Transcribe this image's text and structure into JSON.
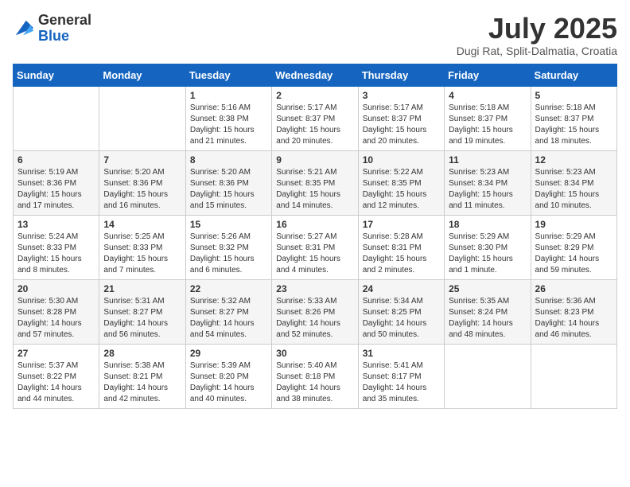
{
  "logo": {
    "general": "General",
    "blue": "Blue"
  },
  "title": {
    "month": "July 2025",
    "location": "Dugi Rat, Split-Dalmatia, Croatia"
  },
  "weekdays": [
    "Sunday",
    "Monday",
    "Tuesday",
    "Wednesday",
    "Thursday",
    "Friday",
    "Saturday"
  ],
  "weeks": [
    [
      {
        "day": "",
        "info": ""
      },
      {
        "day": "",
        "info": ""
      },
      {
        "day": "1",
        "info": "Sunrise: 5:16 AM\nSunset: 8:38 PM\nDaylight: 15 hours and 21 minutes."
      },
      {
        "day": "2",
        "info": "Sunrise: 5:17 AM\nSunset: 8:37 PM\nDaylight: 15 hours and 20 minutes."
      },
      {
        "day": "3",
        "info": "Sunrise: 5:17 AM\nSunset: 8:37 PM\nDaylight: 15 hours and 20 minutes."
      },
      {
        "day": "4",
        "info": "Sunrise: 5:18 AM\nSunset: 8:37 PM\nDaylight: 15 hours and 19 minutes."
      },
      {
        "day": "5",
        "info": "Sunrise: 5:18 AM\nSunset: 8:37 PM\nDaylight: 15 hours and 18 minutes."
      }
    ],
    [
      {
        "day": "6",
        "info": "Sunrise: 5:19 AM\nSunset: 8:36 PM\nDaylight: 15 hours and 17 minutes."
      },
      {
        "day": "7",
        "info": "Sunrise: 5:20 AM\nSunset: 8:36 PM\nDaylight: 15 hours and 16 minutes."
      },
      {
        "day": "8",
        "info": "Sunrise: 5:20 AM\nSunset: 8:36 PM\nDaylight: 15 hours and 15 minutes."
      },
      {
        "day": "9",
        "info": "Sunrise: 5:21 AM\nSunset: 8:35 PM\nDaylight: 15 hours and 14 minutes."
      },
      {
        "day": "10",
        "info": "Sunrise: 5:22 AM\nSunset: 8:35 PM\nDaylight: 15 hours and 12 minutes."
      },
      {
        "day": "11",
        "info": "Sunrise: 5:23 AM\nSunset: 8:34 PM\nDaylight: 15 hours and 11 minutes."
      },
      {
        "day": "12",
        "info": "Sunrise: 5:23 AM\nSunset: 8:34 PM\nDaylight: 15 hours and 10 minutes."
      }
    ],
    [
      {
        "day": "13",
        "info": "Sunrise: 5:24 AM\nSunset: 8:33 PM\nDaylight: 15 hours and 8 minutes."
      },
      {
        "day": "14",
        "info": "Sunrise: 5:25 AM\nSunset: 8:33 PM\nDaylight: 15 hours and 7 minutes."
      },
      {
        "day": "15",
        "info": "Sunrise: 5:26 AM\nSunset: 8:32 PM\nDaylight: 15 hours and 6 minutes."
      },
      {
        "day": "16",
        "info": "Sunrise: 5:27 AM\nSunset: 8:31 PM\nDaylight: 15 hours and 4 minutes."
      },
      {
        "day": "17",
        "info": "Sunrise: 5:28 AM\nSunset: 8:31 PM\nDaylight: 15 hours and 2 minutes."
      },
      {
        "day": "18",
        "info": "Sunrise: 5:29 AM\nSunset: 8:30 PM\nDaylight: 15 hours and 1 minute."
      },
      {
        "day": "19",
        "info": "Sunrise: 5:29 AM\nSunset: 8:29 PM\nDaylight: 14 hours and 59 minutes."
      }
    ],
    [
      {
        "day": "20",
        "info": "Sunrise: 5:30 AM\nSunset: 8:28 PM\nDaylight: 14 hours and 57 minutes."
      },
      {
        "day": "21",
        "info": "Sunrise: 5:31 AM\nSunset: 8:27 PM\nDaylight: 14 hours and 56 minutes."
      },
      {
        "day": "22",
        "info": "Sunrise: 5:32 AM\nSunset: 8:27 PM\nDaylight: 14 hours and 54 minutes."
      },
      {
        "day": "23",
        "info": "Sunrise: 5:33 AM\nSunset: 8:26 PM\nDaylight: 14 hours and 52 minutes."
      },
      {
        "day": "24",
        "info": "Sunrise: 5:34 AM\nSunset: 8:25 PM\nDaylight: 14 hours and 50 minutes."
      },
      {
        "day": "25",
        "info": "Sunrise: 5:35 AM\nSunset: 8:24 PM\nDaylight: 14 hours and 48 minutes."
      },
      {
        "day": "26",
        "info": "Sunrise: 5:36 AM\nSunset: 8:23 PM\nDaylight: 14 hours and 46 minutes."
      }
    ],
    [
      {
        "day": "27",
        "info": "Sunrise: 5:37 AM\nSunset: 8:22 PM\nDaylight: 14 hours and 44 minutes."
      },
      {
        "day": "28",
        "info": "Sunrise: 5:38 AM\nSunset: 8:21 PM\nDaylight: 14 hours and 42 minutes."
      },
      {
        "day": "29",
        "info": "Sunrise: 5:39 AM\nSunset: 8:20 PM\nDaylight: 14 hours and 40 minutes."
      },
      {
        "day": "30",
        "info": "Sunrise: 5:40 AM\nSunset: 8:18 PM\nDaylight: 14 hours and 38 minutes."
      },
      {
        "day": "31",
        "info": "Sunrise: 5:41 AM\nSunset: 8:17 PM\nDaylight: 14 hours and 35 minutes."
      },
      {
        "day": "",
        "info": ""
      },
      {
        "day": "",
        "info": ""
      }
    ]
  ]
}
